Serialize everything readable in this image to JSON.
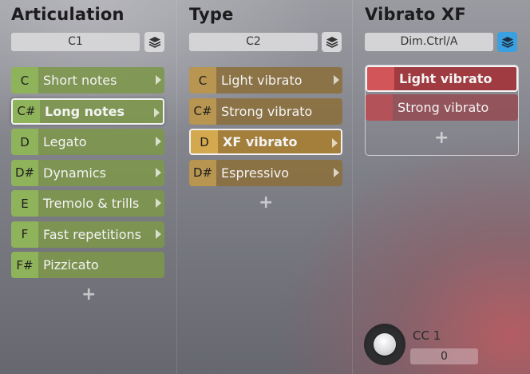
{
  "columns": [
    {
      "title": "Articulation",
      "selector": "C1",
      "rows": [
        {
          "key": "C",
          "label": "Short notes"
        },
        {
          "key": "C#",
          "label": "Long notes"
        },
        {
          "key": "D",
          "label": "Legato"
        },
        {
          "key": "D#",
          "label": "Dynamics"
        },
        {
          "key": "E",
          "label": "Tremolo & trills"
        },
        {
          "key": "F",
          "label": "Fast repetitions"
        },
        {
          "key": "F#",
          "label": "Pizzicato"
        }
      ],
      "selected_row": "Long notes"
    },
    {
      "title": "Type",
      "selector": "C2",
      "rows": [
        {
          "key": "C",
          "label": "Light vibrato"
        },
        {
          "key": "C#",
          "label": "Strong vibrato"
        },
        {
          "key": "D",
          "label": "XF vibrato"
        },
        {
          "key": "D#",
          "label": "Espressivo"
        }
      ],
      "selected_row": "XF vibrato"
    },
    {
      "title": "Vibrato XF",
      "selector": "Dim.Ctrl/A",
      "rows": [
        {
          "key": "",
          "label": "Light vibrato"
        },
        {
          "key": "",
          "label": "Strong vibrato"
        }
      ],
      "selected_row": "Light vibrato"
    }
  ],
  "add_symbol": "+",
  "knob": {
    "label": "CC 1",
    "value": "0"
  },
  "icons": {
    "layer": "layers-icon",
    "submenu": "chevron-right-icon",
    "add": "plus-icon"
  },
  "colors": {
    "articulation_accent": "#8fb35a",
    "type_accent": "#b89550",
    "vibrato_accent": "#c24e55",
    "layer_button_active": "#3ba0e0"
  }
}
